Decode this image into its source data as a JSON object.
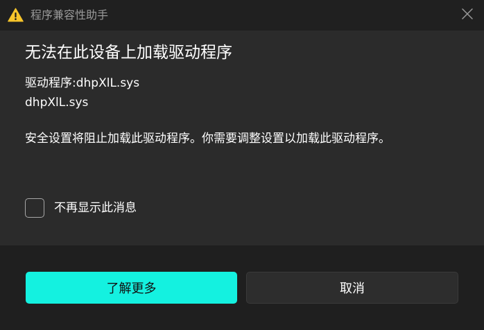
{
  "window": {
    "app_title": "程序兼容性助手",
    "warning_icon": "warning-icon",
    "close_icon": "close-icon"
  },
  "dialog": {
    "heading": "无法在此设备上加载驱动程序",
    "driver_label_line": "驱动程序:dhpXlL.sys",
    "driver_file_line": "dhpXlL.sys",
    "message": "安全设置将阻止加载此驱动程序。你需要调整设置以加载此驱动程序。",
    "checkbox_label": "不再显示此消息",
    "checkbox_checked": false
  },
  "buttons": {
    "learn_more": "了解更多",
    "cancel": "取消"
  },
  "colors": {
    "accent": "#14f1e0",
    "title_bar": "#202020",
    "content_bg": "#2b2b2b",
    "footer_bg": "#1f1f1f",
    "warning_yellow": "#f7c52b"
  }
}
